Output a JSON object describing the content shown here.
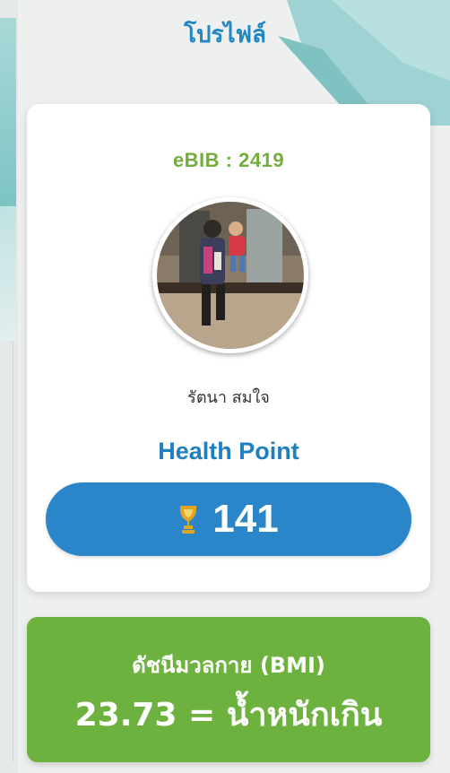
{
  "header": {
    "title": "โปรไฟล์"
  },
  "profile": {
    "ebib": "eBIB : 2419",
    "name": "รัตนา สมใจ"
  },
  "health_point": {
    "label": "Health Point",
    "value": "141",
    "icon": "trophy-icon"
  },
  "bmi": {
    "title": "ดัชนีมวลกาย (BMI)",
    "result": "23.73 = น้ำหนักเกิน"
  },
  "colors": {
    "title_blue": "#1f88c2",
    "ebib_green": "#74ad3e",
    "pill_blue": "#2a86c9",
    "bmi_green": "#6db23e",
    "trophy_gold": "#e0a521"
  }
}
